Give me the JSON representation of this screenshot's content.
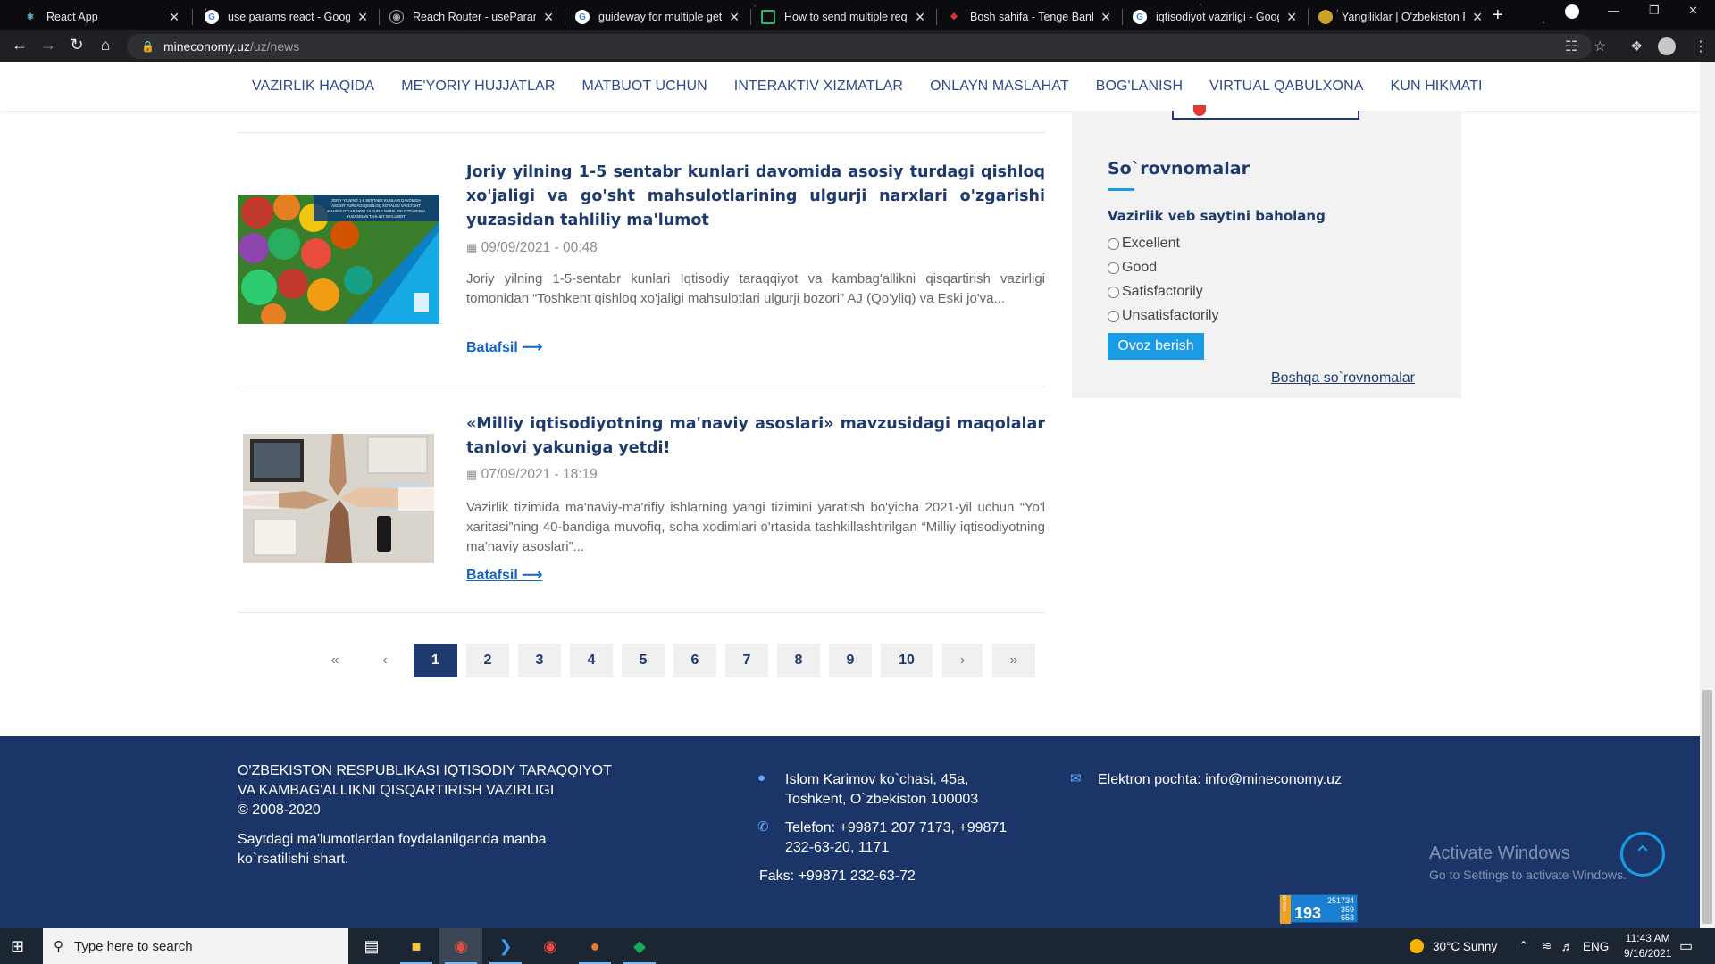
{
  "browser": {
    "tabs": [
      {
        "title": "React App",
        "favicon": "react-icon",
        "color": "#61dafb"
      },
      {
        "title": "use params react - Google",
        "favicon": "google-icon",
        "color": "#4285f4"
      },
      {
        "title": "Reach Router - useParams",
        "favicon": "reach-router-icon",
        "color": "#888888"
      },
      {
        "title": "guideway for multiple get",
        "favicon": "google-icon",
        "color": "#4285f4"
      },
      {
        "title": "How to send multiple requ",
        "favicon": "stackoverflow-icon",
        "color": "#2bb673"
      },
      {
        "title": "Bosh sahifa - Tenge Bank",
        "favicon": "tenge-bank-icon",
        "color": "#e53935"
      },
      {
        "title": "iqtisodiyot vazirligi - Goog",
        "favicon": "google-icon",
        "color": "#4285f4"
      },
      {
        "title": "Yangiliklar | O'zbekiston Re",
        "favicon": "uz-emblem-icon",
        "color": "#c9a227"
      }
    ],
    "url_host": "mineconomy.uz",
    "url_path": "/uz/news"
  },
  "nav": {
    "items": [
      "VAZIRLIK HAQIDA",
      "ME'YORIY HUJJATLAR",
      "MATBUOT UCHUN",
      "INTERAKTIV XIZMATLAR",
      "ONLAYN MASLAHAT",
      "BOG'LANISH",
      "VIRTUAL QABULXONA",
      "KUN HIKMATI"
    ]
  },
  "news": [
    {
      "title": "Joriy yilning 1-5 sentabr kunlari davomida asosiy turdagi qishloq xo'jaligi va go'sht mahsulotlarining ulgurji narxlari o'zgarishi yuzasidan tahliliy ma'lumot",
      "date": "09/09/2021 - 00:48",
      "excerpt": "Joriy yilning 1-5-sentabr kunlari Iqtisodiy taraqqiyot va kambag'allikni qisqartirish vazirligi tomonidan “Toshkent qishloq xo'jaligi mahsulotlari ulgurji bozori” AJ (Qo'yliq) va Eski jo'va...",
      "more": "Batafsil",
      "image": "vegetables-image",
      "image_caption": "JORIY YILNING 1-5 SENTABR KUNLARI DAVOMIDA ASOSIY TURDAGI QISHLOQ XO'JALIGI VA GO'SHT MAHSULOTLARINING ULGURJI NARXLARI O'ZGARISHI YUZASIDAN TAHLILIY MA'LUMOT"
    },
    {
      "title": "«Milliy iqtisodiyotning ma'naviy asoslari» mavzusidagi maqolalar tanlovi yakuniga yetdi!",
      "date": "07/09/2021 - 18:19",
      "excerpt": "Vazirlik tizimida ma'naviy-ma'rifiy ishlarning yangi tizimini yaratish bo'yicha 2021-yil uchun “Yo'l xaritasi”ning 40-bandiga muvofiq, soha xodimlari o'rtasida tashkillashtirilgan “Milliy iqtisodiyotning ma'naviy asoslari”...",
      "more": "Batafsil",
      "image": "team-fists-image"
    }
  ],
  "pagination": {
    "first": "«",
    "prev": "‹",
    "pages": [
      "1",
      "2",
      "3",
      "4",
      "5",
      "6",
      "7",
      "8",
      "9",
      "10"
    ],
    "current": "1",
    "next": "›",
    "last": "»"
  },
  "poll": {
    "heading": "So`rovnomalar",
    "question": "Vazirlik veb saytini baholang",
    "options": [
      "Excellent",
      "Good",
      "Satisfactorily",
      "Unsatisfactorily"
    ],
    "vote_button": "Ovoz berish",
    "other_link": "Boshqa so`rovnomalar"
  },
  "footer": {
    "org_line1": "O'ZBEKISTON RESPUBLIKASI IQTISODIY TARAQQIYOT",
    "org_line2": "VA KAMBAG'ALLIKNI QISQARTIRISH VAZIRLIGI",
    "copyright": "© 2008-2020",
    "notice_line1": "Saytdagi ma'lumotlardan foydalanilganda manba",
    "notice_line2": "ko`rsatilishi shart.",
    "address_line1": "Islom Karimov ko`chasi, 45a,",
    "address_line2": "Toshkent, O`zbekiston 100003",
    "phone_line1": "Telefon: +99871 207 7173, +99871",
    "phone_line2": "232-63-20, 1171",
    "fax": "Faks: +99871 232-63-72",
    "email": "Elektron pochta: info@mineconomy.uz",
    "counter_big": "193",
    "counter_small": [
      "251734",
      "359",
      "653"
    ],
    "counter_side": "TAS-IX"
  },
  "windows": {
    "activate_title": "Activate Windows",
    "activate_sub": "Go to Settings to activate Windows."
  },
  "taskbar": {
    "search_placeholder": "Type here to search",
    "weather": "30°C  Sunny",
    "language": "ENG",
    "time": "11:43 AM",
    "date": "9/16/2021"
  }
}
